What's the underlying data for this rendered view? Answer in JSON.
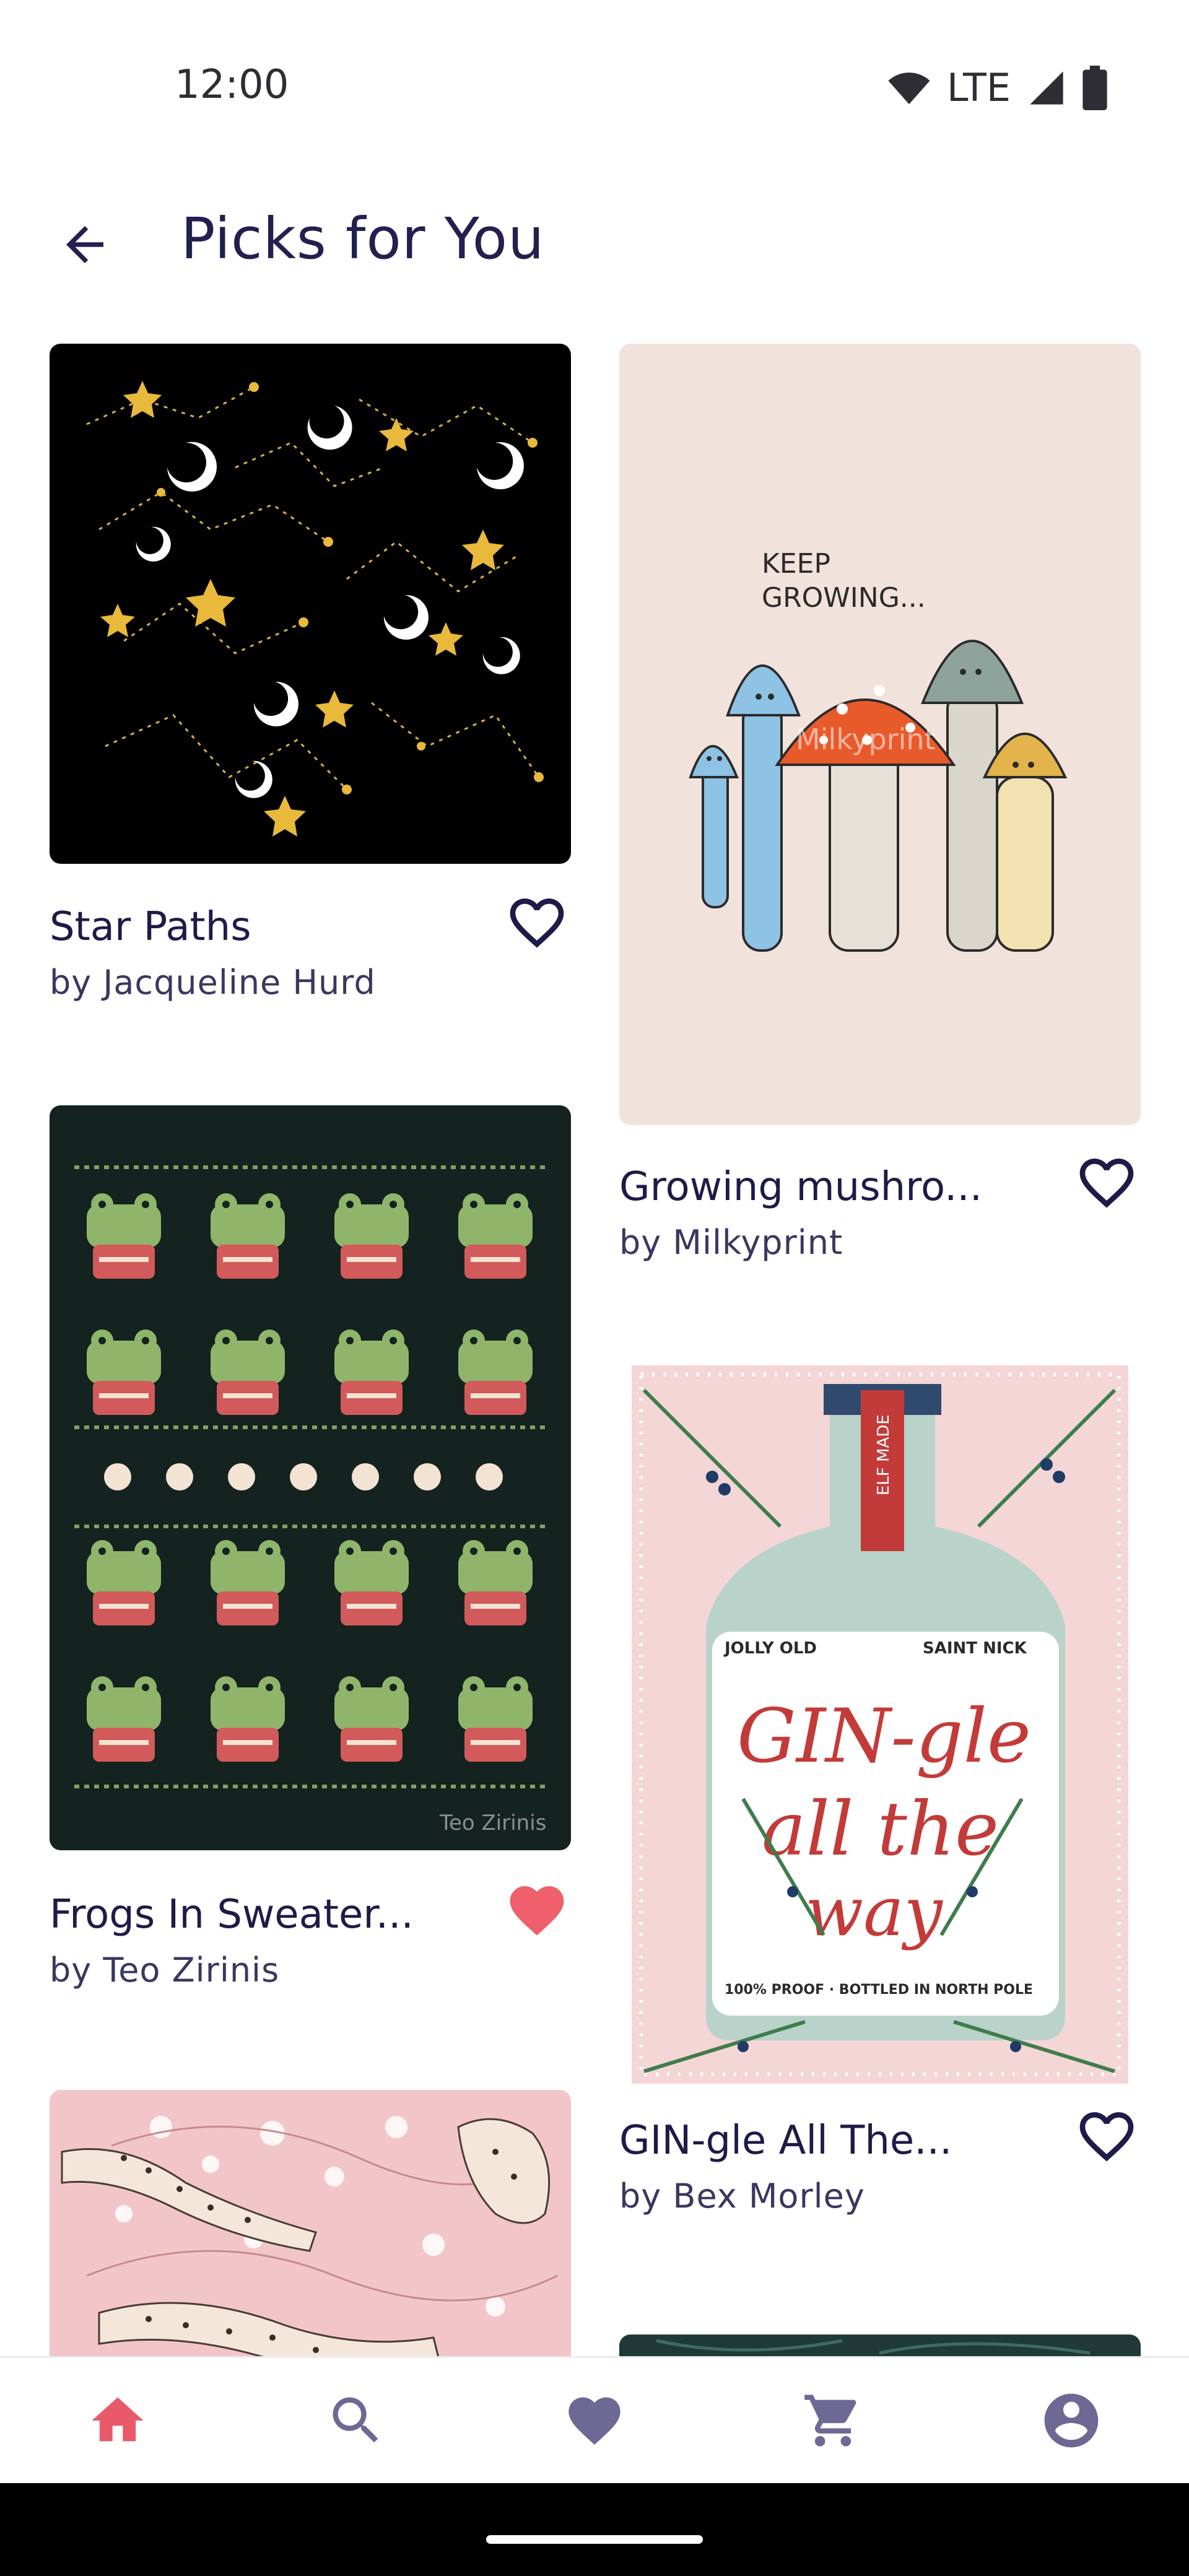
{
  "status_bar": {
    "time": "12:00",
    "network": "LTE"
  },
  "header": {
    "title": "Picks for You"
  },
  "cards": [
    {
      "title": "Star Paths",
      "artist": "by Jacqueline Hurd",
      "favorited": false
    },
    {
      "title": "Growing mushro...",
      "artist": "by Milkyprint",
      "favorited": false,
      "art_text_1": "KEEP",
      "art_text_2": "GROWING...",
      "watermark": "Milkyprint"
    },
    {
      "title": "Frogs In Sweater...",
      "artist": "by Teo Zirinis",
      "favorited": true,
      "watermark": "Teo Zirinis"
    },
    {
      "title": "GIN-gle All The...",
      "artist": "by Bex Morley",
      "favorited": false,
      "art_text_1": "JOLLY OLD",
      "art_text_2": "SAINT NICK",
      "art_text_3": "GIN-gle",
      "art_text_4": "all the",
      "art_text_5": "way",
      "art_text_6": "100% PROOF · BOTTLED IN NORTH POLE",
      "art_text_7": "ELF MADE"
    }
  ],
  "bottom_nav": {
    "items": [
      {
        "name": "home",
        "active": true
      },
      {
        "name": "search",
        "active": false
      },
      {
        "name": "favorites",
        "active": false
      },
      {
        "name": "cart",
        "active": false
      },
      {
        "name": "account",
        "active": false
      }
    ]
  },
  "colors": {
    "title": "#23204f",
    "icon": "#6e6894",
    "active": "#e85a6a",
    "heart_filled": "#ef5f6c"
  }
}
